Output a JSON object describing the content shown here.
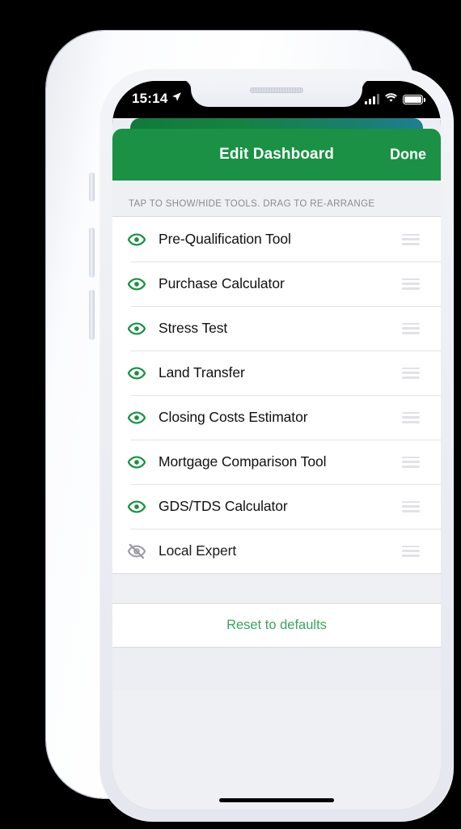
{
  "status_bar": {
    "time": "15:14",
    "location_icon": "location-arrow-icon",
    "cellular_icon": "cellular-bars-icon",
    "wifi_icon": "wifi-icon",
    "battery_icon": "battery-full-icon"
  },
  "navbar": {
    "title": "Edit Dashboard",
    "done_label": "Done",
    "background_color": "#1a9144"
  },
  "background_card": {
    "gradient_from": "#117a3c",
    "gradient_to": "#1e7f95"
  },
  "section": {
    "hint": "TAP TO SHOW/HIDE TOOLS. DRAG TO RE-ARRANGE"
  },
  "tools": [
    {
      "label": "Pre-Qualification Tool",
      "visible": true,
      "eye_icon": "eye-icon",
      "handle_icon": "drag-handle-icon"
    },
    {
      "label": "Purchase Calculator",
      "visible": true,
      "eye_icon": "eye-icon",
      "handle_icon": "drag-handle-icon"
    },
    {
      "label": "Stress Test",
      "visible": true,
      "eye_icon": "eye-icon",
      "handle_icon": "drag-handle-icon"
    },
    {
      "label": "Land Transfer",
      "visible": true,
      "eye_icon": "eye-icon",
      "handle_icon": "drag-handle-icon"
    },
    {
      "label": "Closing Costs Estimator",
      "visible": true,
      "eye_icon": "eye-icon",
      "handle_icon": "drag-handle-icon"
    },
    {
      "label": "Mortgage Comparison Tool",
      "visible": true,
      "eye_icon": "eye-icon",
      "handle_icon": "drag-handle-icon"
    },
    {
      "label": "GDS/TDS Calculator",
      "visible": true,
      "eye_icon": "eye-icon",
      "handle_icon": "drag-handle-icon"
    },
    {
      "label": "Local Expert",
      "visible": false,
      "eye_icon": "eye-slash-icon",
      "handle_icon": "drag-handle-icon"
    }
  ],
  "footer": {
    "reset_label": "Reset to defaults",
    "reset_color": "#3aa45f"
  },
  "colors": {
    "eye_visible": "#1a9144",
    "eye_hidden": "#9a9aa0",
    "list_background": "#ffffff",
    "page_background": "#eff0f4"
  }
}
